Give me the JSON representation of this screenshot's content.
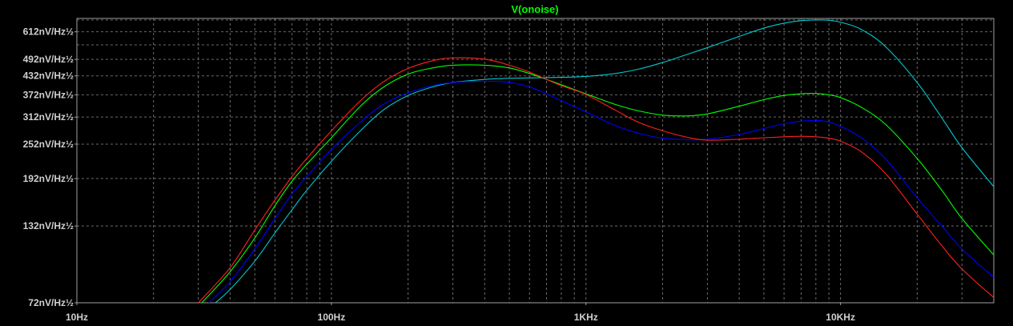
{
  "chart_data": {
    "type": "line",
    "title": "V(onoise)",
    "title_color": "#00ff00",
    "background_color": "#000000",
    "axis_color": "#a0a0a0",
    "grid_color": "#6a6a6a",
    "grid": true,
    "x_scale": "log",
    "y_scale": "log",
    "xlim": [
      10,
      40000
    ],
    "ylim": [
      72,
      680
    ],
    "x_ticks": [
      {
        "value": 10,
        "label": "10Hz"
      },
      {
        "value": 100,
        "label": "100Hz"
      },
      {
        "value": 1000,
        "label": "1KHz"
      },
      {
        "value": 10000,
        "label": "10KHz"
      }
    ],
    "y_ticks": [
      {
        "value": 72,
        "label": "72nV/Hz½"
      },
      {
        "value": 132,
        "label": "132nV/Hz½"
      },
      {
        "value": 192,
        "label": "192nV/Hz½"
      },
      {
        "value": 252,
        "label": "252nV/Hz½"
      },
      {
        "value": 312,
        "label": "312nV/Hz½"
      },
      {
        "value": 372,
        "label": "372nV/Hz½"
      },
      {
        "value": 432,
        "label": "432nV/Hz½"
      },
      {
        "value": 492,
        "label": "492nV/Hz½"
      },
      {
        "value": 552,
        "label": ""
      },
      {
        "value": 612,
        "label": "612nV/Hz½"
      },
      {
        "value": 672,
        "label": ""
      }
    ],
    "series": [
      {
        "color": "#00c8d0",
        "x": [
          35,
          40,
          50,
          60,
          70,
          80,
          100,
          130,
          160,
          200,
          250,
          300,
          400,
          500,
          600,
          700,
          800,
          1000,
          1300,
          1600,
          2000,
          2500,
          3000,
          4000,
          5000,
          6000,
          7000,
          8000,
          9000,
          10000,
          12000,
          15000,
          20000,
          25000,
          30000,
          40000
        ],
        "y": [
          72,
          80,
          100,
          125,
          150,
          175,
          220,
          280,
          330,
          370,
          396,
          410,
          420,
          424,
          425,
          426,
          427,
          430,
          440,
          455,
          480,
          512,
          540,
          590,
          630,
          655,
          668,
          672,
          670,
          660,
          625,
          545,
          410,
          310,
          245,
          180
        ]
      },
      {
        "color": "#0000ff",
        "x": [
          33,
          40,
          50,
          60,
          70,
          80,
          100,
          130,
          160,
          200,
          250,
          300,
          400,
          500,
          600,
          700,
          800,
          1000,
          1300,
          1600,
          2000,
          2500,
          3000,
          4000,
          5000,
          6000,
          7000,
          8000,
          9000,
          10000,
          12000,
          15000,
          20000,
          25000,
          30000,
          40000
        ],
        "y": [
          72,
          85,
          110,
          140,
          170,
          195,
          242,
          300,
          345,
          378,
          400,
          410,
          414,
          410,
          396,
          375,
          355,
          325,
          292,
          275,
          264,
          261,
          262,
          272,
          285,
          296,
          302,
          304,
          300,
          290,
          266,
          225,
          165,
          132,
          110,
          88
        ]
      },
      {
        "color": "#00ff00",
        "x": [
          31,
          40,
          50,
          60,
          70,
          80,
          100,
          130,
          160,
          200,
          250,
          300,
          400,
          500,
          600,
          700,
          800,
          1000,
          1300,
          1600,
          2000,
          2500,
          3000,
          4000,
          5000,
          6000,
          7000,
          8000,
          9000,
          10000,
          12000,
          15000,
          20000,
          25000,
          30000,
          40000
        ],
        "y": [
          72,
          92,
          120,
          155,
          188,
          215,
          265,
          340,
          395,
          438,
          460,
          470,
          470,
          460,
          440,
          420,
          403,
          375,
          345,
          328,
          317,
          315,
          320,
          340,
          358,
          370,
          375,
          376,
          372,
          364,
          338,
          295,
          225,
          175,
          140,
          105
        ]
      },
      {
        "color": "#ff2020",
        "x": [
          30,
          40,
          50,
          60,
          70,
          80,
          100,
          130,
          160,
          200,
          250,
          300,
          400,
          500,
          600,
          700,
          800,
          1000,
          1300,
          1600,
          2000,
          2500,
          3000,
          4000,
          5000,
          6000,
          7000,
          8000,
          9000,
          10000,
          12000,
          15000,
          20000,
          25000,
          30000,
          40000
        ],
        "y": [
          72,
          95,
          128,
          162,
          195,
          225,
          280,
          355,
          412,
          458,
          487,
          498,
          493,
          470,
          445,
          420,
          400,
          373,
          330,
          300,
          280,
          266,
          260,
          262,
          265,
          267,
          268,
          267,
          264,
          258,
          238,
          200,
          145,
          113,
          94,
          75
        ]
      }
    ]
  }
}
